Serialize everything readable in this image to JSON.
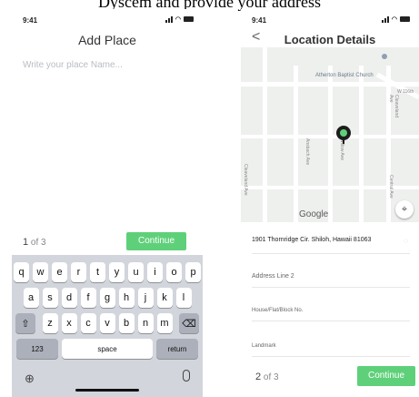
{
  "top_caption": "Dyscem and provide your address",
  "status": {
    "time": "9:41"
  },
  "screen1": {
    "title": "Add Place",
    "placeholder": "Write your place Name...",
    "step_current": "1",
    "step_rest": " of 3",
    "continue_label": "Continue",
    "keyboard": {
      "row1": [
        "q",
        "w",
        "e",
        "r",
        "t",
        "y",
        "u",
        "i",
        "o",
        "p"
      ],
      "row2": [
        "a",
        "s",
        "d",
        "f",
        "g",
        "h",
        "j",
        "k",
        "l"
      ],
      "row3": [
        "z",
        "x",
        "c",
        "v",
        "b",
        "n",
        "m"
      ],
      "numbers_label": "123",
      "space_label": "space",
      "return_label": "return"
    }
  },
  "screen2": {
    "title": "Location Details",
    "back_icon": "<",
    "map_poi": "Atherton Baptist Church",
    "map_streets": [
      "Cleaveland Ave",
      "Ansbach Ave",
      "Willow Ave",
      "Central Ave",
      "Cleaveland Ave",
      "W 116th"
    ],
    "google_label": "Google",
    "address": "1901 Thornridge Cir. Shiloh, Hawaii 81063",
    "fields": [
      "Address Line 2",
      "House/Flat/Block No.",
      "Landmark"
    ],
    "step_current": "2",
    "step_rest": " of 3",
    "continue_label": "Continue"
  },
  "colors": {
    "accent": "#5fd07a",
    "pin": "#1d1d1d",
    "pin_center": "#5fd07a",
    "keyboard_bg": "#d2d5db"
  }
}
